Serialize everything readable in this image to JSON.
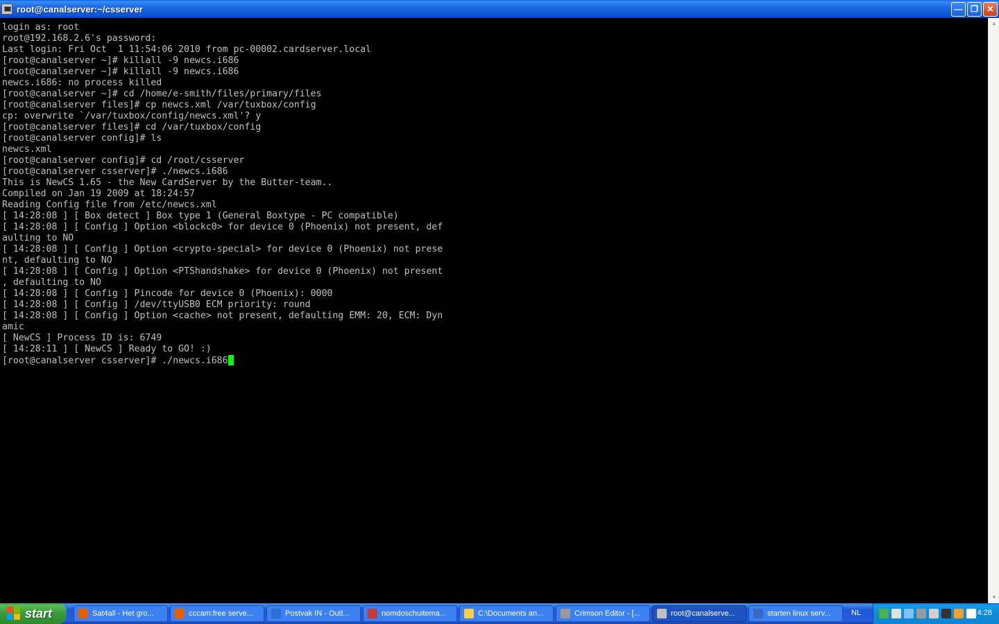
{
  "window": {
    "title": "root@canalserver:~/csserver",
    "buttons": [
      "minimize",
      "maximize",
      "close"
    ]
  },
  "terminal": {
    "lines": [
      "login as: root",
      "root@192.168.2.6's password:",
      "Last login: Fri Oct  1 11:54:06 2010 from pc-00002.cardserver.local",
      "[root@canalserver ~]# killall -9 newcs.i686",
      "[root@canalserver ~]# killall -9 newcs.i686",
      "newcs.i686: no process killed",
      "[root@canalserver ~]# cd /home/e-smith/files/primary/files",
      "[root@canalserver files]# cp newcs.xml /var/tuxbox/config",
      "cp: overwrite `/var/tuxbox/config/newcs.xml'? y",
      "[root@canalserver files]# cd /var/tuxbox/config",
      "[root@canalserver config]# ls",
      "newcs.xml",
      "[root@canalserver config]# cd /root/csserver",
      "[root@canalserver csserver]# ./newcs.i686",
      "This is NewCS 1.65 - the New CardServer by the Butter-team..",
      "Compiled on Jan 19 2009 at 18:24:57",
      "Reading Config file from /etc/newcs.xml",
      "[ 14:28:08 ] [ Box detect ] Box type 1 (General Boxtype - PC compatible)",
      "[ 14:28:08 ] [ Config ] Option <blockc0> for device 0 (Phoenix) not present, def",
      "aulting to NO",
      "[ 14:28:08 ] [ Config ] Option <crypto-special> for device 0 (Phoenix) not prese",
      "nt, defaulting to NO",
      "[ 14:28:08 ] [ Config ] Option <PTShandshake> for device 0 (Phoenix) not present",
      ", defaulting to NO",
      "[ 14:28:08 ] [ Config ] Pincode for device 0 (Phoenix): 0000",
      "[ 14:28:08 ] [ Config ] /dev/ttyUSB0 ECM priority: round",
      "[ 14:28:08 ] [ Config ] Option <cache> not present, defaulting EMM: 20, ECM: Dyn",
      "amic",
      "[ NewCS ] Process ID is: 6749",
      "[ 14:28:11 ] [ NewCS ] Ready to GO! :)"
    ],
    "prompt_line": "[root@canalserver csserver]# ./newcs.i686",
    "cursor_color": "#00ff00",
    "text_color": "#c0c0c0",
    "background": "#000000"
  },
  "taskbar": {
    "start_label": "start",
    "tasks": [
      {
        "label": "Sat4all - Het gro...",
        "icon": "firefox-icon",
        "color": "#e66000"
      },
      {
        "label": "cccam:free serve...",
        "icon": "firefox-icon",
        "color": "#e66000"
      },
      {
        "label": "Postvak IN - Outl...",
        "icon": "outlook-icon",
        "color": "#2a6fd4"
      },
      {
        "label": "nomdoschuitema...",
        "icon": "messenger-icon",
        "color": "#c23a3a"
      },
      {
        "label": "C:\\Documents an...",
        "icon": "folder-icon",
        "color": "#f4d04a"
      },
      {
        "label": "Crimson Editor - [...",
        "icon": "editor-icon",
        "color": "#9a9a9a"
      },
      {
        "label": "root@canalserve...",
        "icon": "putty-icon",
        "color": "#bfbfbf",
        "active": true
      },
      {
        "label": "starten linux serv...",
        "icon": "word-icon",
        "color": "#3a66c4"
      }
    ],
    "language": "NL",
    "tray_icons": [
      "msn-icon",
      "network-icon",
      "network-icon-2",
      "antivirus-icon",
      "sound-icon",
      "video-icon",
      "firefox-tray-icon",
      "display-icon"
    ],
    "clock": "14:28"
  }
}
